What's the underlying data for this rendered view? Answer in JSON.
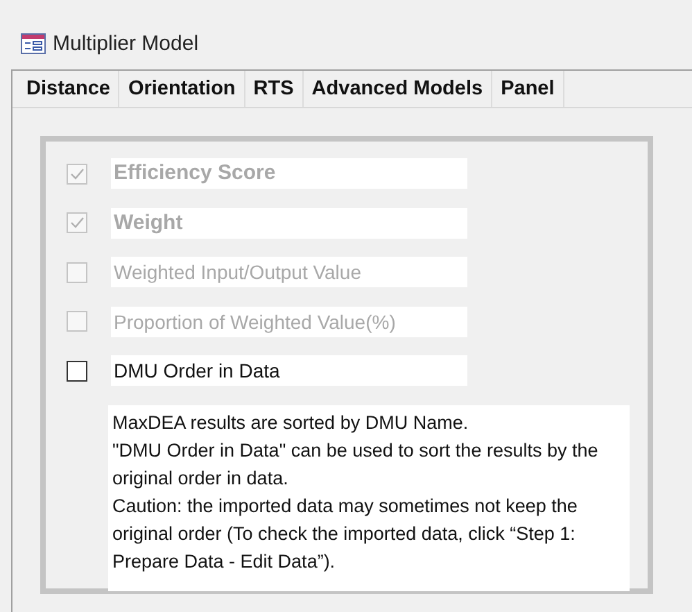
{
  "window": {
    "title": "Multiplier Model"
  },
  "tabs": [
    {
      "label": "Distance"
    },
    {
      "label": "Orientation"
    },
    {
      "label": "RTS"
    },
    {
      "label": "Advanced Models"
    },
    {
      "label": "Panel"
    }
  ],
  "options": [
    {
      "label": "Efficiency Score",
      "checked": true,
      "disabled": true,
      "kind": "bold"
    },
    {
      "label": "Weight",
      "checked": true,
      "disabled": true,
      "kind": "bold"
    },
    {
      "label": "Weighted Input/Output Value",
      "checked": false,
      "disabled": true,
      "kind": "plain"
    },
    {
      "label": "Proportion of Weighted Value(%)",
      "checked": false,
      "disabled": true,
      "kind": "plain"
    },
    {
      "label": "DMU Order in Data",
      "checked": false,
      "disabled": false,
      "kind": "plain"
    }
  ],
  "note": [
    "MaxDEA results are sorted by DMU Name.",
    "\"DMU Order in Data\" can be used to sort the results by the original order in data.",
    "Caution: the imported data may sometimes not keep the original order (To check the imported data, click “Step 1: Prepare Data - Edit Data”)."
  ]
}
